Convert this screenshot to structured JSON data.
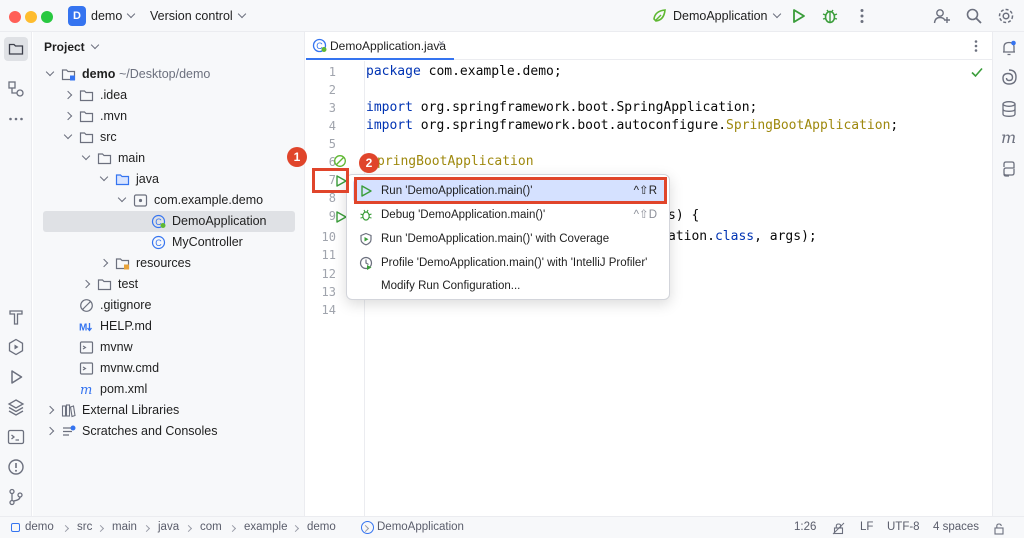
{
  "titlebar": {
    "project_initial": "D",
    "project_name": "demo",
    "vcs_label": "Version control",
    "run_config": "DemoApplication"
  },
  "project_panel": {
    "title": "Project",
    "tree": [
      {
        "label": "demo",
        "suffix": "~/Desktop/demo",
        "depth": 0,
        "arrow": "open",
        "icon": "module-folder-icon"
      },
      {
        "label": ".idea",
        "depth": 1,
        "arrow": "closed",
        "icon": "folder-icon"
      },
      {
        "label": ".mvn",
        "depth": 1,
        "arrow": "closed",
        "icon": "folder-icon"
      },
      {
        "label": "src",
        "depth": 1,
        "arrow": "open",
        "icon": "folder-icon"
      },
      {
        "label": "main",
        "depth": 2,
        "arrow": "open",
        "icon": "folder-icon"
      },
      {
        "label": "java",
        "depth": 3,
        "arrow": "open",
        "icon": "source-folder-icon"
      },
      {
        "label": "com.example.demo",
        "depth": 4,
        "arrow": "open",
        "icon": "package-icon"
      },
      {
        "label": "DemoApplication",
        "depth": 5,
        "arrow": "none",
        "icon": "spring-class-icon",
        "selected": true
      },
      {
        "label": "MyController",
        "depth": 5,
        "arrow": "none",
        "icon": "class-icon"
      },
      {
        "label": "resources",
        "depth": 3,
        "arrow": "closed",
        "icon": "resources-folder-icon"
      },
      {
        "label": "test",
        "depth": 2,
        "arrow": "closed",
        "icon": "folder-icon"
      },
      {
        "label": ".gitignore",
        "depth": 1,
        "arrow": "none",
        "icon": "ignore-file-icon"
      },
      {
        "label": "HELP.md",
        "depth": 1,
        "arrow": "none",
        "icon": "markdown-icon"
      },
      {
        "label": "mvnw",
        "depth": 1,
        "arrow": "none",
        "icon": "shell-file-icon"
      },
      {
        "label": "mvnw.cmd",
        "depth": 1,
        "arrow": "none",
        "icon": "shell-file-icon"
      },
      {
        "label": "pom.xml",
        "depth": 1,
        "arrow": "none",
        "icon": "maven-icon"
      },
      {
        "label": "External Libraries",
        "depth": 0,
        "arrow": "closed",
        "icon": "libraries-icon"
      },
      {
        "label": "Scratches and Consoles",
        "depth": 0,
        "arrow": "closed",
        "icon": "scratches-icon"
      }
    ]
  },
  "editor": {
    "tab_label": "DemoApplication.java",
    "tab_close": "×",
    "line_numbers": [
      "1",
      "2",
      "3",
      "4",
      "5",
      "6",
      "7",
      "8",
      "9",
      "10",
      "11",
      "12",
      "13",
      "14"
    ],
    "code": {
      "l1_kw": "package",
      "l1_rest": " com.example.demo;",
      "l3_kw": "import",
      "l3_rest": " org.springframework.boot.SpringApplication;",
      "l4_kw": "import",
      "l4_rest": " org.springframework.boot.autoconfigure.",
      "l4_ann": "SpringBootApplication",
      "l4_end": ";",
      "l6_ann": "pringBootApplication",
      "l9_tail": "s) {",
      "l10_tail": "ation.",
      "l10_kw": "class",
      "l10_end": ", args);"
    }
  },
  "popup": {
    "items": [
      {
        "label": "Run 'DemoApplication.main()'",
        "shortcut": "^⇧R",
        "icon": "run-icon"
      },
      {
        "label": "Debug 'DemoApplication.main()'",
        "shortcut": "^⇧D",
        "icon": "debug-icon"
      },
      {
        "label": "Run 'DemoApplication.main()' with Coverage",
        "shortcut": "",
        "icon": "coverage-icon"
      },
      {
        "label": "Profile 'DemoApplication.main()' with 'IntelliJ Profiler'",
        "shortcut": "",
        "icon": "profiler-icon"
      },
      {
        "label": "Modify Run Configuration...",
        "shortcut": "",
        "icon": ""
      }
    ]
  },
  "callouts": {
    "one": "1",
    "two": "2",
    "color": "#e0452b"
  },
  "statusbar": {
    "breadcrumbs": [
      "demo",
      "src",
      "main",
      "java",
      "com",
      "example",
      "demo",
      "DemoApplication"
    ],
    "position": "1:26",
    "line_sep": "LF",
    "encoding": "UTF-8",
    "indent": "4 spaces"
  },
  "colors": {
    "accent": "#3574f0",
    "run_green": "#3a9d3a",
    "spring_green": "#5fb832"
  }
}
